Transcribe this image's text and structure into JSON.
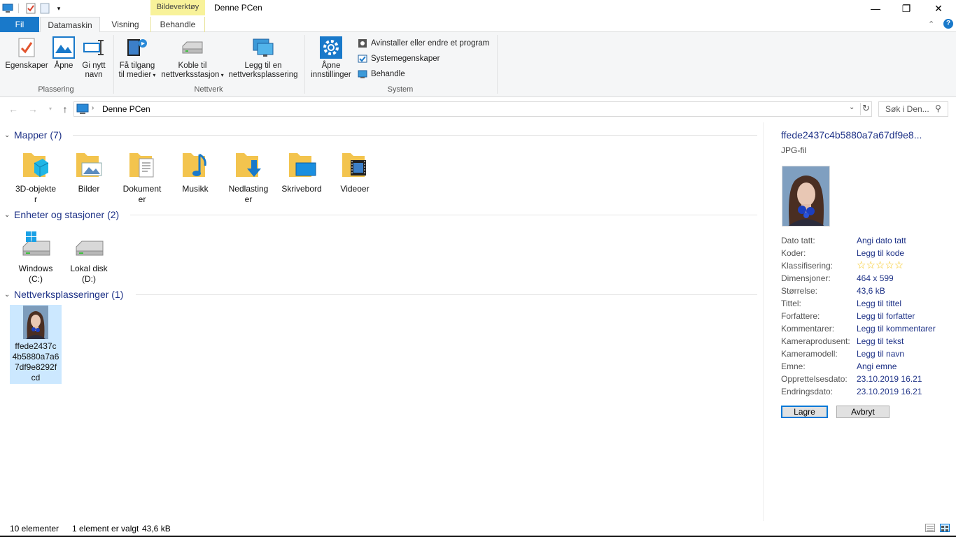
{
  "titlebar": {
    "context_tab": "Bildeverktøy",
    "title": "Denne PCen",
    "minimize": "—",
    "maximize": "❐",
    "close": "✕"
  },
  "tabs": {
    "file": "Fil",
    "computer": "Datamaskin",
    "view": "Visning",
    "manage": "Behandle"
  },
  "ribbon": {
    "properties": "Egenskaper",
    "open": "Åpne",
    "rename_1": "Gi nytt",
    "rename_2": "navn",
    "placement_label": "Plassering",
    "access_media_1": "Få tilgang",
    "access_media_2": "til medier",
    "map_drive_1": "Koble til",
    "map_drive_2": "nettverksstasjon",
    "add_network_1": "Legg til en",
    "add_network_2": "nettverksplassering",
    "network_label": "Nettverk",
    "open_settings_1": "Åpne",
    "open_settings_2": "innstillinger",
    "uninstall": "Avinstaller eller endre et program",
    "system_props": "Systemegenskaper",
    "manage": "Behandle",
    "system_label": "System"
  },
  "nav": {
    "path": "Denne PCen",
    "search_placeholder": "Søk i Den..."
  },
  "groups": {
    "folders": "Mapper (7)",
    "devices": "Enheter og stasjoner (2)",
    "network": "Nettverksplasseringer (1)"
  },
  "folders": [
    {
      "label_1": "3D-objekte",
      "label_2": "r"
    },
    {
      "label_1": "Bilder",
      "label_2": ""
    },
    {
      "label_1": "Dokument",
      "label_2": "er"
    },
    {
      "label_1": "Musikk",
      "label_2": ""
    },
    {
      "label_1": "Nedlasting",
      "label_2": "er"
    },
    {
      "label_1": "Skrivebord",
      "label_2": ""
    },
    {
      "label_1": "Videoer",
      "label_2": ""
    }
  ],
  "drives": [
    {
      "label_1": "Windows",
      "label_2": "(C:)"
    },
    {
      "label_1": "Lokal disk",
      "label_2": "(D:)"
    }
  ],
  "network_item": {
    "l1": "ffede2437c",
    "l2": "4b5880a7a6",
    "l3": "7df9e8292f",
    "l4": "cd"
  },
  "details": {
    "title": "ffede2437c4b5880a7a67df9e8...",
    "type": "JPG-fil",
    "props": [
      {
        "k": "Dato tatt:",
        "v": "Angi dato tatt"
      },
      {
        "k": "Koder:",
        "v": "Legg til kode"
      },
      {
        "k": "Klassifisering:",
        "v": ""
      },
      {
        "k": "Dimensjoner:",
        "v": "464 x 599"
      },
      {
        "k": "Størrelse:",
        "v": "43,6 kB"
      },
      {
        "k": "Tittel:",
        "v": "Legg til tittel"
      },
      {
        "k": "Forfattere:",
        "v": "Legg til forfatter"
      },
      {
        "k": "Kommentarer:",
        "v": "Legg til kommentarer"
      },
      {
        "k": "Kameraprodusent:",
        "v": "Legg til tekst"
      },
      {
        "k": "Kameramodell:",
        "v": "Legg til navn"
      },
      {
        "k": "Emne:",
        "v": "Angi emne"
      },
      {
        "k": "Opprettelsesdato:",
        "v": "23.10.2019 16.21"
      },
      {
        "k": "Endringsdato:",
        "v": "23.10.2019 16.21"
      }
    ],
    "rating_stars": 5,
    "save": "Lagre",
    "cancel": "Avbryt"
  },
  "status": {
    "count": "10 elementer",
    "selected": "1 element er valgt",
    "size": "43,6 kB"
  },
  "colors": {
    "accent": "#1979ca",
    "link": "#1e3287",
    "folder": "#f3c44e",
    "context_tab": "#f8f29a"
  }
}
